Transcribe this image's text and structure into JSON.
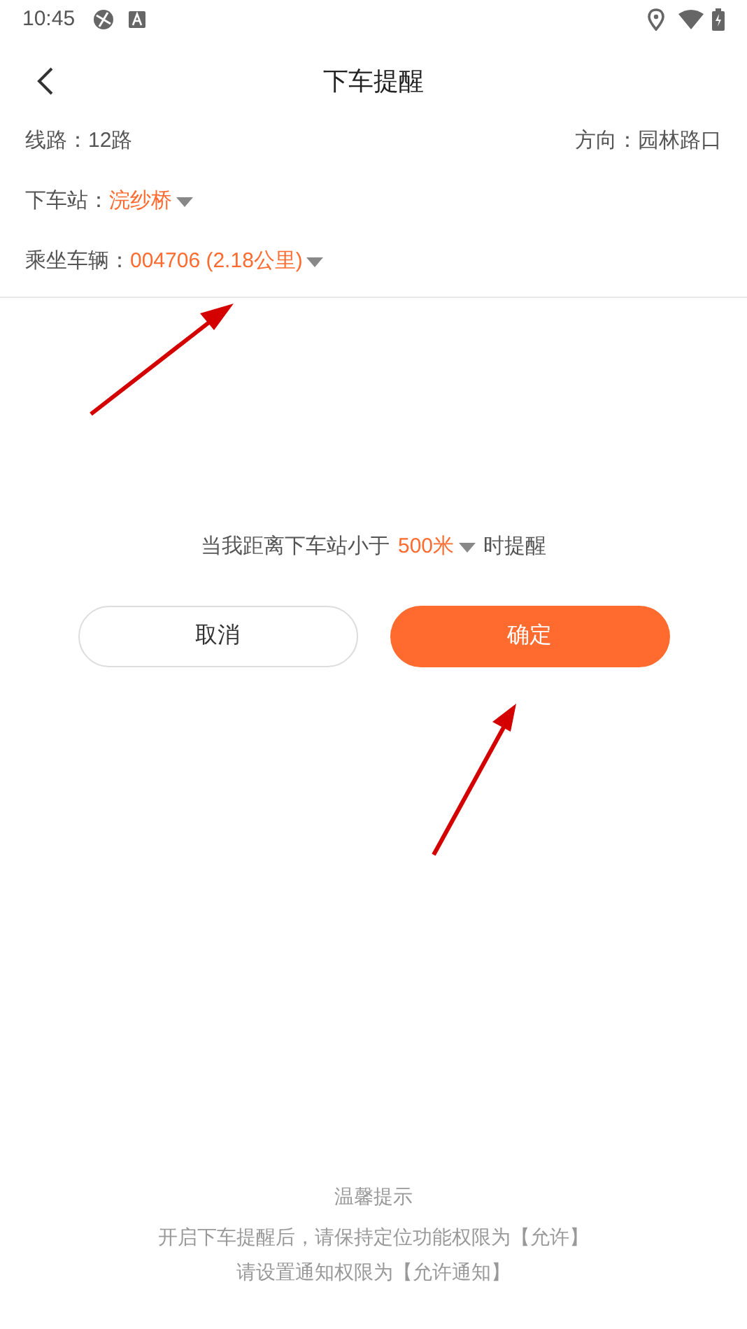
{
  "status_bar": {
    "time": "10:45"
  },
  "header": {
    "title": "下车提醒"
  },
  "info": {
    "route_label": "线路：",
    "route": "12路",
    "direction_label": "方向：",
    "direction": "园林路口"
  },
  "fields": [
    {
      "label": "下车站：",
      "value": "浣纱桥"
    },
    {
      "label": "乘坐车辆：",
      "value": "004706 (2.18公里)"
    }
  ],
  "reminder": {
    "before": "当我距离下车站小于",
    "distance": "500米",
    "after": "时提醒"
  },
  "buttons": [
    {
      "kind": "secondary",
      "label": "取消"
    },
    {
      "kind": "primary",
      "label": "确定"
    }
  ],
  "tips": {
    "title": "温馨提示",
    "lines": [
      "开启下车提醒后，请保持定位功能权限为【允许】",
      "请设置通知权限为【允许通知】"
    ]
  }
}
